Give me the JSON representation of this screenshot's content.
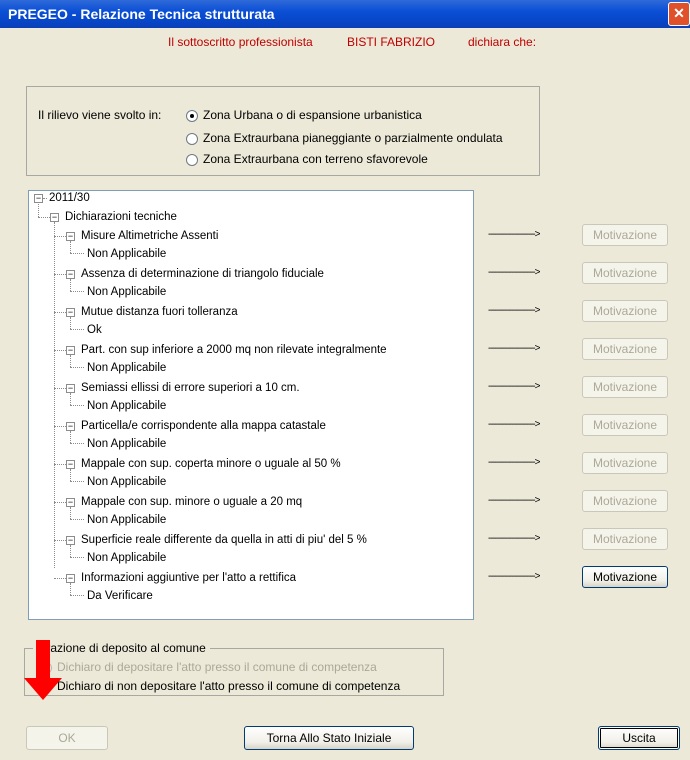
{
  "window": {
    "title": "PREGEO - Relazione Tecnica strutturata",
    "close_glyph": "✕"
  },
  "declaration": {
    "prefix": "Il sottoscritto professionista",
    "name": "BISTI FABRIZIO",
    "suffix": "dichiara che:"
  },
  "survey": {
    "label": "Il rilievo viene svolto in:",
    "options": [
      {
        "label": "Zona Urbana o di espansione urbanistica",
        "selected": true
      },
      {
        "label": "Zona Extraurbana pianeggiante o parzialmente ondulata",
        "selected": false
      },
      {
        "label": "Zona Extraurbana con terreno sfavorevole",
        "selected": false
      }
    ]
  },
  "tree": {
    "root": "2011/30",
    "section": "Dichiarazioni tecniche",
    "items": [
      {
        "label": "Misure Altimetriche Assenti",
        "status": "Non Applicabile",
        "button": "Motivazione",
        "enabled": false
      },
      {
        "label": "Assenza di determinazione di triangolo fiduciale",
        "status": "Non Applicabile",
        "button": "Motivazione",
        "enabled": false
      },
      {
        "label": "Mutue distanza fuori tolleranza",
        "status": "Ok",
        "button": "Motivazione",
        "enabled": false
      },
      {
        "label": "Part. con sup inferiore a 2000 mq non rilevate integralmente",
        "status": "Non Applicabile",
        "button": "Motivazione",
        "enabled": false
      },
      {
        "label": "Semiassi ellissi di errore superiori a 10 cm.",
        "status": "Non Applicabile",
        "button": "Motivazione",
        "enabled": false
      },
      {
        "label": "Particella/e corrispondente alla mappa catastale",
        "status": "Non Applicabile",
        "button": "Motivazione",
        "enabled": false
      },
      {
        "label": "Mappale con sup. coperta minore o uguale al 50 %",
        "status": "Non Applicabile",
        "button": "Motivazione",
        "enabled": false
      },
      {
        "label": "Mappale con sup. minore o uguale a 20 mq",
        "status": "Non Applicabile",
        "button": "Motivazione",
        "enabled": false
      },
      {
        "label": "Superficie reale differente da quella in atti di piu' del 5 %",
        "status": "Non Applicabile",
        "button": "Motivazione",
        "enabled": false
      },
      {
        "label": "Informazioni aggiuntive per l'atto a rettifica",
        "status": "Da Verificare",
        "button": "Motivazione",
        "enabled": true
      }
    ]
  },
  "deposit": {
    "legend": "iarazione di deposito al comune",
    "options": [
      {
        "label": "Dichiaro di depositare l'atto presso il comune di competenza",
        "enabled": false
      },
      {
        "label": "Dichiaro di non depositare l'atto presso il comune di competenza",
        "enabled": true
      }
    ]
  },
  "buttons": {
    "ok": "OK",
    "reset": "Torna Allo Stato Iniziale",
    "exit": "Uscita"
  },
  "colors": {
    "annotation_arrow": "#ff0000",
    "declaration_text": "#c00000",
    "titlebar": "#0a4fd6"
  }
}
